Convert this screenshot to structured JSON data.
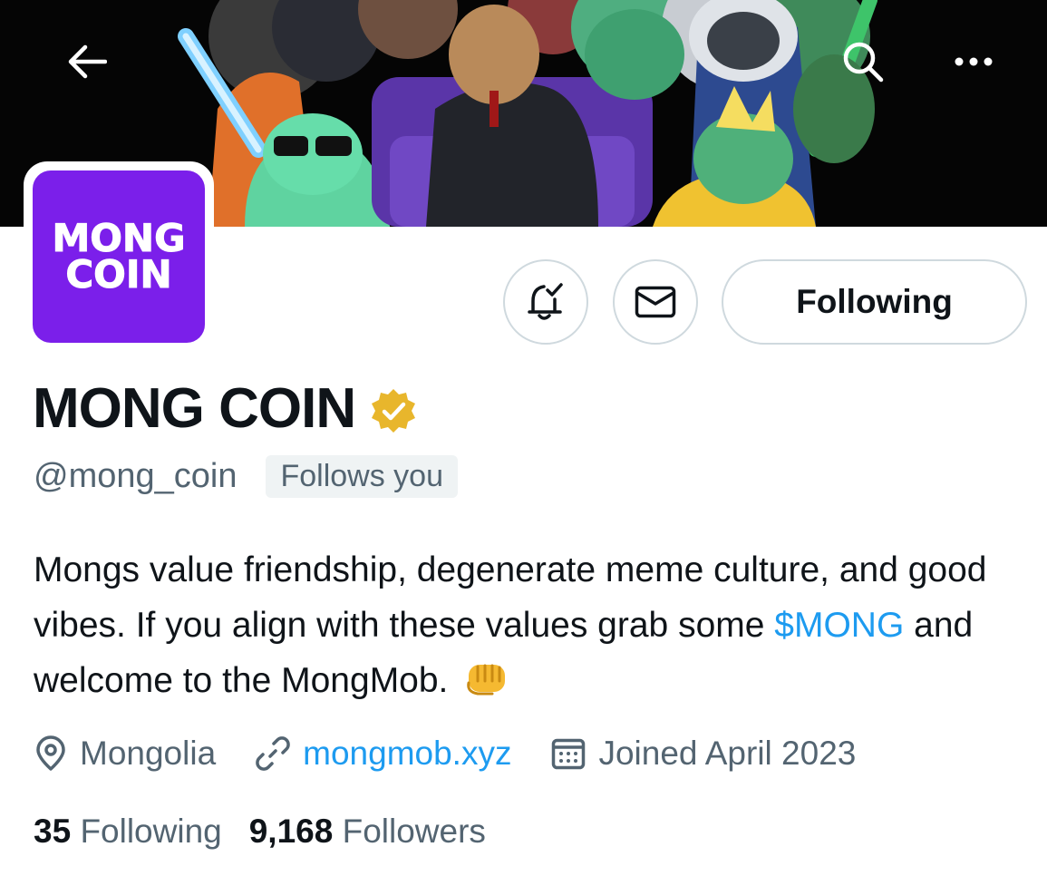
{
  "header": {
    "back_icon": "arrow-left-icon",
    "search_icon": "search-icon",
    "more_icon": "more-horizontal-icon"
  },
  "avatar": {
    "line1": "MONG",
    "line2": "COIN",
    "color": "#7b1fea"
  },
  "actions": {
    "notify_icon": "bell-check-icon",
    "message_icon": "envelope-icon",
    "follow_label": "Following"
  },
  "profile": {
    "display_name": "MONG COIN",
    "verified_badge": "gold-verified-badge",
    "handle": "@mong_coin",
    "follows_you": "Follows you"
  },
  "bio": {
    "part1": "Mongs value friendship, degenerate meme culture, and good vibes. If you align with these values grab some ",
    "cashtag": "$MONG",
    "part2": " and welcome to the MongMob.",
    "emoji": "oncoming-fist-emoji"
  },
  "meta": {
    "location": "Mongolia",
    "website": "mongmob.xyz",
    "joined": "Joined April 2023"
  },
  "stats": {
    "following_count": "35",
    "following_label": "Following",
    "followers_count": "9,168",
    "followers_label": "Followers"
  },
  "colors": {
    "accent": "#1d9bf0",
    "secondary_text": "#536471",
    "border": "#cfd9de",
    "verified_gold": "#e8b62c"
  }
}
